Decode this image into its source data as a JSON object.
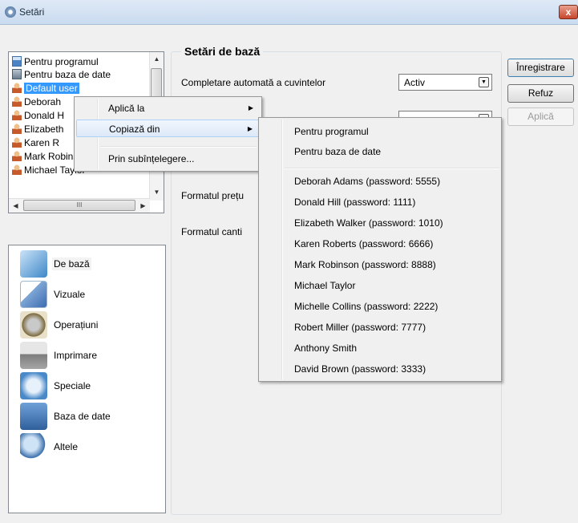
{
  "window": {
    "title": "Setări",
    "close_label": "x"
  },
  "users_list": {
    "items": [
      {
        "label": "Pentru programul",
        "icon": "app-icon"
      },
      {
        "label": "Pentru baza de date",
        "icon": "database-icon"
      },
      {
        "label": "Default user",
        "icon": "user-icon",
        "selected": true
      },
      {
        "label": "Deborah",
        "icon": "user-icon"
      },
      {
        "label": "Donald H",
        "icon": "user-icon"
      },
      {
        "label": "Elizabeth",
        "icon": "user-icon"
      },
      {
        "label": "Karen R",
        "icon": "user-icon"
      },
      {
        "label": "Mark Robinson (passwor",
        "icon": "user-icon"
      },
      {
        "label": "Michael Taylor",
        "icon": "user-icon"
      }
    ],
    "hscroll_thumb_glyph": "III"
  },
  "categories": [
    {
      "label": "De bază",
      "icon": "basic-settings-icon",
      "active": true
    },
    {
      "label": "Vizuale",
      "icon": "visual-icon"
    },
    {
      "label": "Operațiuni",
      "icon": "operations-icon"
    },
    {
      "label": "Imprimare",
      "icon": "printer-icon"
    },
    {
      "label": "Speciale",
      "icon": "special-icon"
    },
    {
      "label": "Baza de date",
      "icon": "database-icon"
    },
    {
      "label": "Altele",
      "icon": "other-icon"
    }
  ],
  "main": {
    "section_title": "Setări de bază",
    "settings": [
      {
        "label": "Completare automată a cuvintelor",
        "value": "Activ"
      },
      {
        "label": "Formatul prețu"
      },
      {
        "label": "Formatul canti"
      }
    ]
  },
  "buttons": {
    "save": "Înregistrare",
    "cancel": "Refuz",
    "apply": "Aplică"
  },
  "context_menu": {
    "items": [
      {
        "label": "Aplică la",
        "has_submenu": true
      },
      {
        "label": "Copiază din",
        "has_submenu": true,
        "highlighted": true
      },
      {
        "label": "Prin subînțelegere..."
      }
    ],
    "arrow_glyph": "▶"
  },
  "submenu": {
    "top_items": [
      "Pentru programul",
      "Pentru baza de date"
    ],
    "user_items": [
      "Deborah Adams (password: 5555)",
      "Donald Hill (password: 1111)",
      "Elizabeth Walker (password: 1010)",
      "Karen Roberts (password: 6666)",
      "Mark Robinson (password: 8888)",
      "Michael Taylor",
      "Michelle Collins (password: 2222)",
      "Robert Miller (password: 7777)",
      "Anthony Smith",
      "David Brown (password: 3333)"
    ]
  },
  "glyphs": {
    "dropdown": "▼",
    "scroll_up": "▲",
    "scroll_down": "▼",
    "scroll_left": "◀",
    "scroll_right": "▶"
  }
}
